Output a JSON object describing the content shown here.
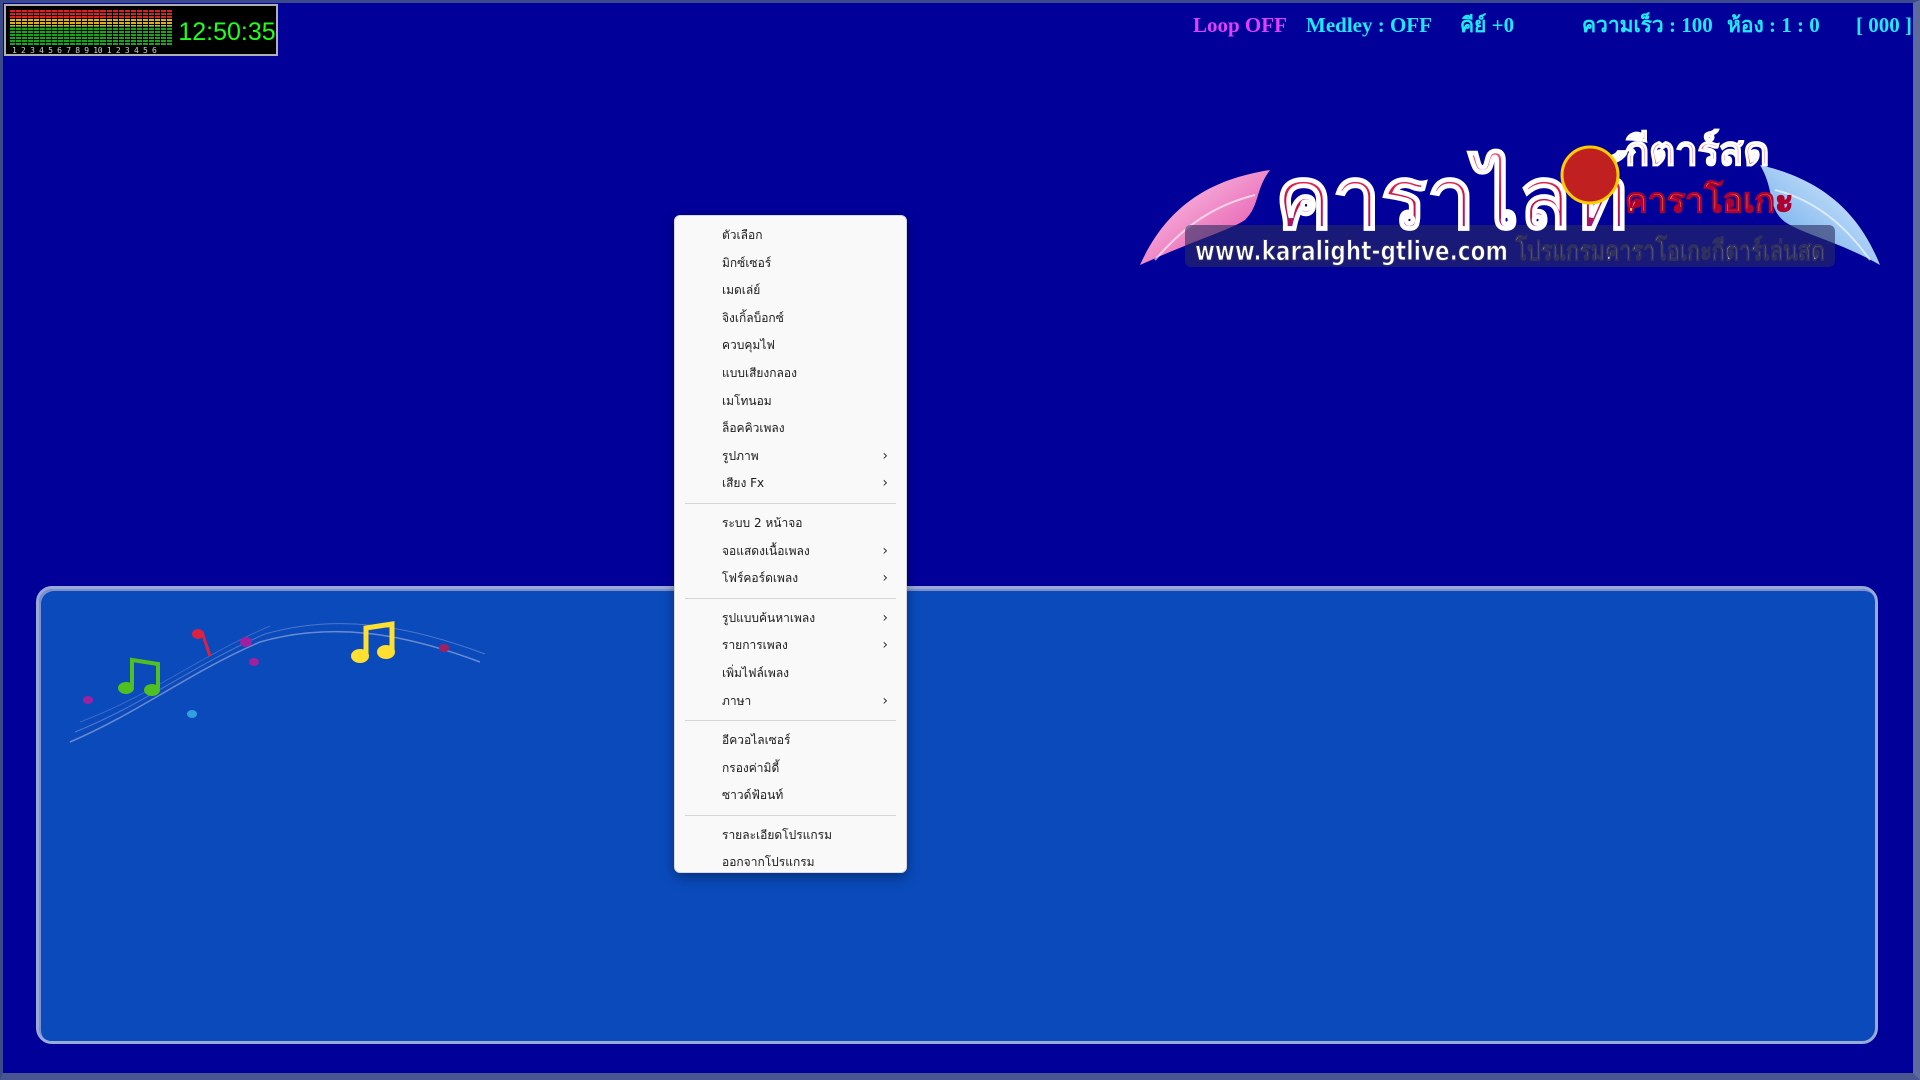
{
  "vu_meter": {
    "bar_count": 27,
    "channel_numbers": "1 2 3 4 5 6 7 8 9 10 1 2 3 4 5 6",
    "clock": "12:50:35"
  },
  "status_bar": {
    "loop": {
      "text": "Loop OFF",
      "color": "#e040ff"
    },
    "medley": {
      "text": "Medley : OFF",
      "color": "#20e8ff"
    },
    "key": {
      "text": "คีย์ +0",
      "color": "#20e8ff"
    },
    "speed": {
      "text": "ความเร็ว : 100",
      "color": "#20e8ff"
    },
    "room": {
      "text": "ห้อง : 1 : 0",
      "color": "#20e8ff"
    },
    "counter": {
      "text": "[ 000 ]",
      "color": "#20e8ff"
    }
  },
  "logo": {
    "main_text": "คาราไลท์",
    "side_top": "กีตาร์สด",
    "side_bottom": "คาราโอเกะ",
    "url_line": "www.karalight-gtlive.com โปรแกรมคาราโอเกะกีตาร์เล่นสด"
  },
  "context_menu": {
    "groups": [
      [
        {
          "label": "ตัวเลือก",
          "submenu": false
        },
        {
          "label": "มิกซ์เซอร์",
          "submenu": false
        },
        {
          "label": "เมดเล่ย์",
          "submenu": false
        },
        {
          "label": "จิงเกิ้ลบ็อกซ์",
          "submenu": false
        },
        {
          "label": "ควบคุมไฟ",
          "submenu": false
        },
        {
          "label": "แบบเสียงกลอง",
          "submenu": false
        },
        {
          "label": "เมโทนอม",
          "submenu": false
        },
        {
          "label": "ล็อคคิวเพลง",
          "submenu": false
        },
        {
          "label": "รูปภาพ",
          "submenu": true
        },
        {
          "label": "เสียง Fx",
          "submenu": true
        }
      ],
      [
        {
          "label": "ระบบ 2 หน้าจอ",
          "submenu": false
        },
        {
          "label": "จอแสดงเนื้อเพลง",
          "submenu": true
        },
        {
          "label": "โฟร์คอร์ดเพลง",
          "submenu": true
        }
      ],
      [
        {
          "label": "รูปแบบค้นหาเพลง",
          "submenu": true
        },
        {
          "label": "รายการเพลง",
          "submenu": true
        },
        {
          "label": "เพิ่มไฟล์เพลง",
          "submenu": false
        },
        {
          "label": "ภาษา",
          "submenu": true
        }
      ],
      [
        {
          "label": "อีควอไลเซอร์",
          "submenu": false
        },
        {
          "label": "กรองค่ามิดี้",
          "submenu": false
        },
        {
          "label": "ซาวด์ฟ้อนท์",
          "submenu": false
        }
      ],
      [
        {
          "label": "รายละเอียดโปรแกรม",
          "submenu": false
        },
        {
          "label": "ออกจากโปรแกรม",
          "submenu": false
        }
      ]
    ]
  }
}
